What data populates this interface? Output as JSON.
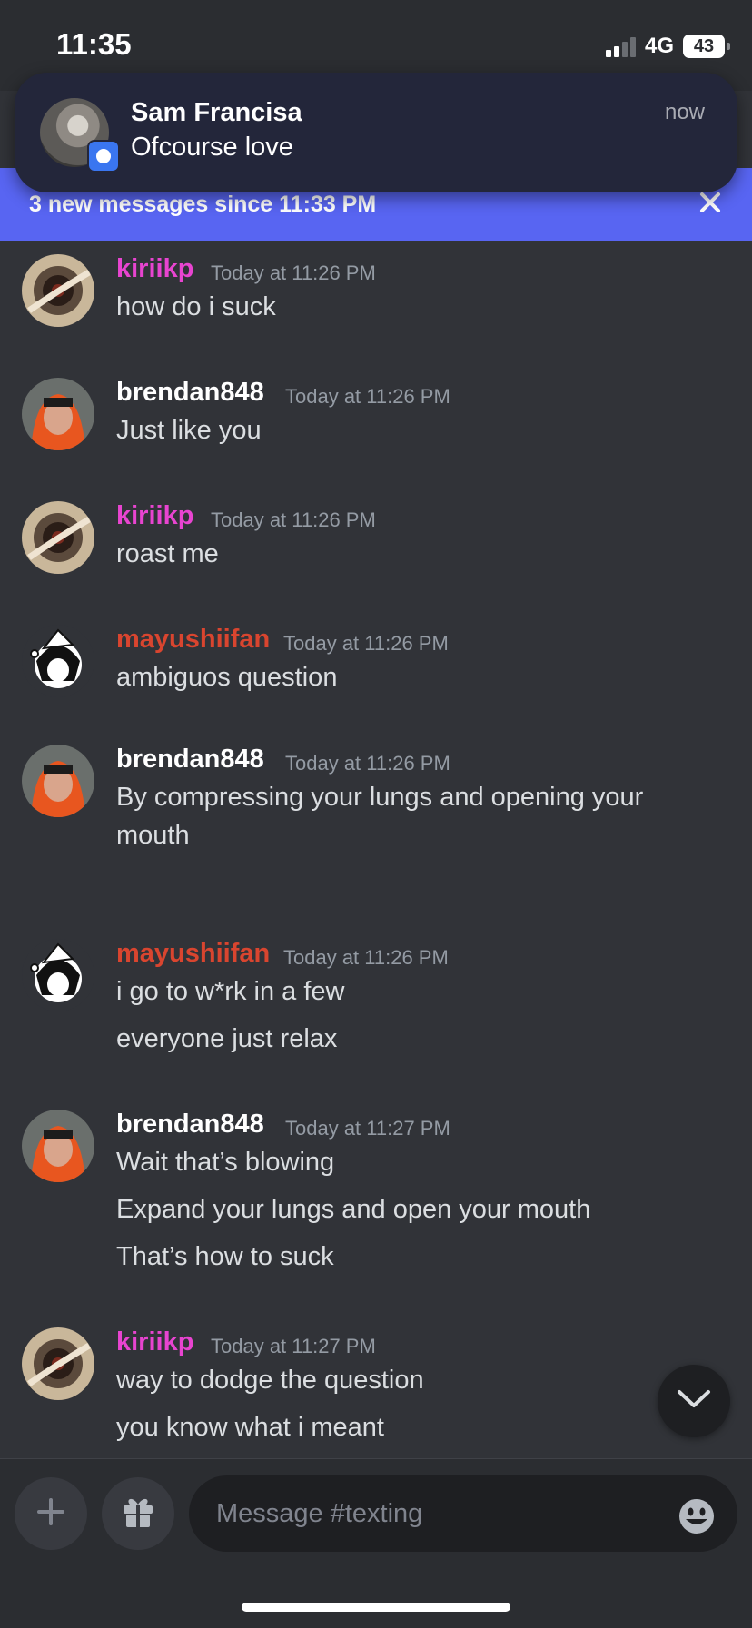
{
  "status_bar": {
    "time": "11:35",
    "network": "4G",
    "battery": "43"
  },
  "notification": {
    "title": "Sam Francisa",
    "body": "Ofcourse love",
    "time": "now"
  },
  "banner": {
    "text": "3 new messages since 11:33 PM",
    "close_icon": "close-icon"
  },
  "messages": [
    {
      "author": "kiriikp",
      "timestamp": "Today at 11:26 PM",
      "lines": [
        "how do i suck"
      ]
    },
    {
      "author": "brendan848",
      "timestamp": "Today at 11:26 PM",
      "lines": [
        "Just like you"
      ]
    },
    {
      "author": "kiriikp",
      "timestamp": "Today at 11:26 PM",
      "lines": [
        "roast me"
      ]
    },
    {
      "author": "mayushiifan",
      "timestamp": "Today at 11:26 PM",
      "lines": [
        "ambiguos question"
      ]
    },
    {
      "author": "brendan848",
      "timestamp": "Today at 11:26 PM",
      "lines": [
        "By compressing your lungs and opening your",
        "mouth"
      ]
    },
    {
      "author": "mayushiifan",
      "timestamp": "Today at 11:26 PM",
      "lines": [
        "i go to w*rk in a few",
        "everyone just relax"
      ]
    },
    {
      "author": "brendan848",
      "timestamp": "Today at 11:27 PM",
      "lines": [
        "Wait that’s blowing",
        "Expand your lungs and open your mouth",
        "That’s how to suck"
      ]
    },
    {
      "author": "kiriikp",
      "timestamp": "Today at 11:27 PM",
      "lines": [
        "way to dodge the question",
        "you know what i meant"
      ]
    }
  ],
  "colors": {
    "kiriikp": "#e844d0",
    "brendan848": "#ffffff",
    "mayushiifan": "#d9452f",
    "accent": "#5865f2"
  },
  "composer": {
    "placeholder": "Message #texting",
    "add_icon": "plus-icon",
    "gift_icon": "gift-icon",
    "emoji_icon": "emoji-icon"
  },
  "scroll_button_icon": "chevron-down-icon"
}
